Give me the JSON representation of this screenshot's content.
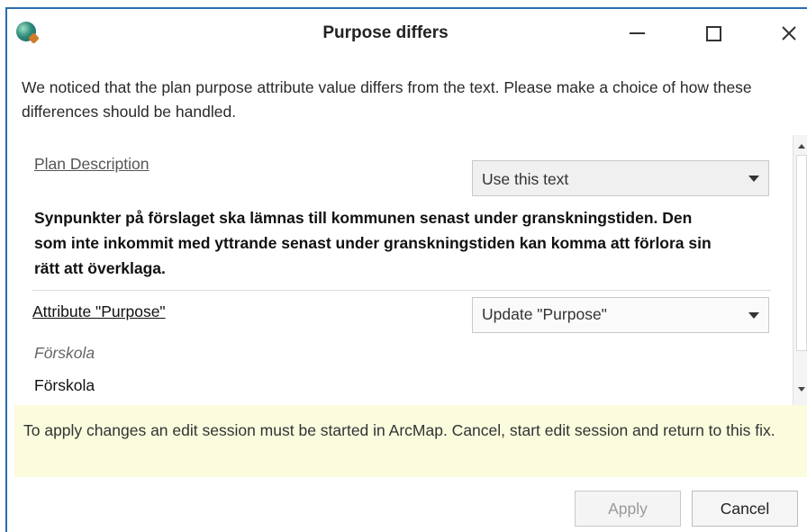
{
  "window": {
    "title": "Purpose differs"
  },
  "intro_text": "We noticed that the plan purpose attribute value differs from the text. Please make a choice of how these differences should be handled.",
  "plan_section": {
    "label": "Plan Description",
    "dropdown_value": "Use this text",
    "text": "Synpunkter på förslaget ska lämnas till kommunen senast under granskningstiden. Den som inte inkommit med yttrande senast under granskningstiden kan komma att förlora sin rätt att överklaga."
  },
  "attribute_section": {
    "label": "Attribute \"Purpose\"",
    "dropdown_value": "Update \"Purpose\"",
    "current_value": "Förskola",
    "new_value": "Förskola"
  },
  "notice": "To apply changes an edit session must be started in ArcMap. Cancel, start edit session and return to this fix.",
  "buttons": {
    "apply": "Apply",
    "cancel": "Cancel"
  }
}
